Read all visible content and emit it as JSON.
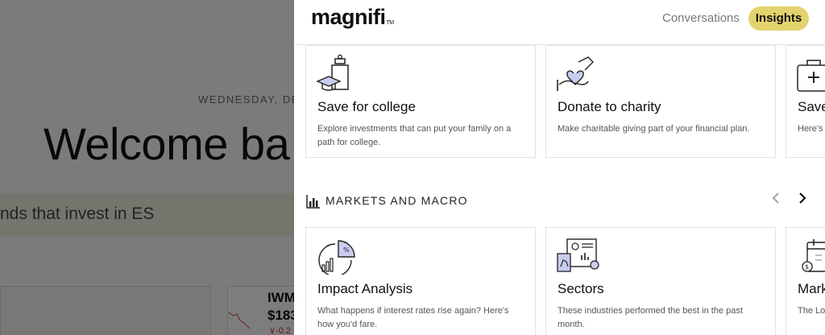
{
  "background": {
    "date": "WEDNESDAY, DE",
    "welcome": "Welcome ba",
    "search_text": "nds that invest in ES",
    "ticker": "IWM",
    "price": "$183",
    "change": "∨-0.2"
  },
  "header": {
    "logo": "magnifi",
    "logo_tm": "TM",
    "nav": {
      "conversations": "Conversations",
      "insights": "Insights"
    }
  },
  "goals_cards": [
    {
      "icon": "graduation-jar-icon",
      "title": "Save for college",
      "description": "Explore investments that can put your family on a path for college."
    },
    {
      "icon": "heart-hand-icon",
      "title": "Donate to charity",
      "description": "Make charitable giving part of your financial plan."
    },
    {
      "icon": "medical-kit-icon",
      "title": "Save",
      "description": "Here's a rainy"
    }
  ],
  "markets_section": {
    "title": "MARKETS AND MACRO",
    "icon": "bar-chart-icon"
  },
  "markets_cards": [
    {
      "icon": "pie-chart-icon",
      "title": "Impact Analysis",
      "description": "What happens if interest rates rise again? Here's how you'd fare."
    },
    {
      "icon": "sectors-dashboard-icon",
      "title": "Sectors",
      "description": "These industries performed the best in the past month."
    },
    {
      "icon": "calendar-icon",
      "title": "Mark",
      "description": "The Lo watchli"
    }
  ],
  "colors": {
    "accent": "#e3d36c",
    "overlay": "rgba(0,0,0,0.5)",
    "icon_fill": "#c9cdf0"
  }
}
